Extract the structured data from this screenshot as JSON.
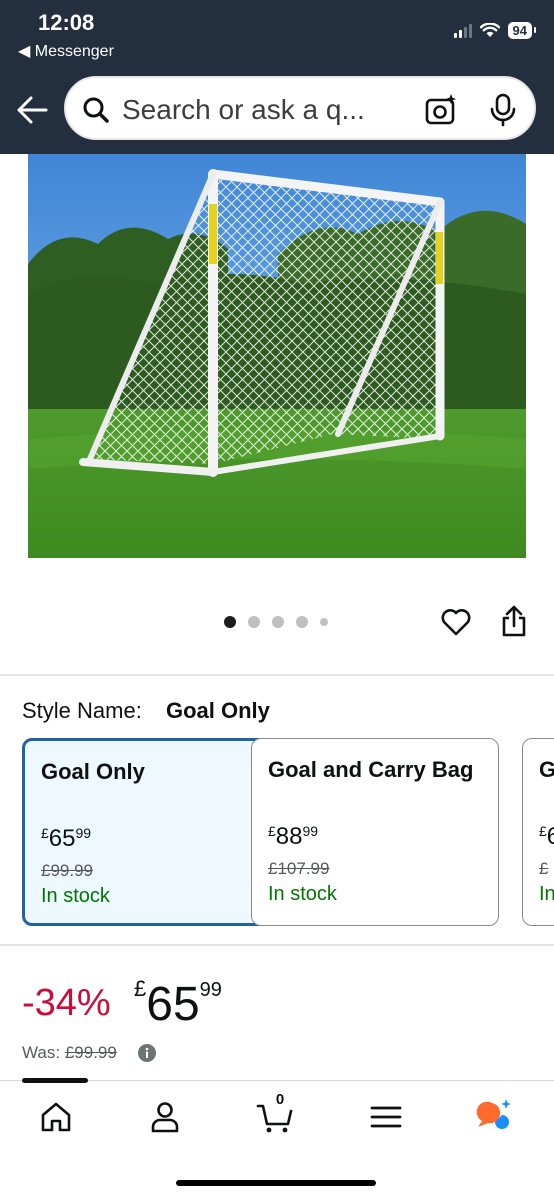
{
  "status_bar": {
    "time": "12:08",
    "back_app": "◀ Messenger",
    "battery": "94"
  },
  "search": {
    "placeholder": "Search or ask a q..."
  },
  "product": {
    "image_alt": "White football goal with net on grass",
    "carousel": {
      "total": 5,
      "active_index": 0
    }
  },
  "style": {
    "label": "Style Name:",
    "selected": "Goal Only",
    "options": [
      {
        "title": "Goal Only",
        "currency": "£",
        "whole": "65",
        "fraction": "99",
        "was": "£99.99",
        "stock": "In stock",
        "selected": true
      },
      {
        "title": "Goal and Carry Bag",
        "currency": "£",
        "whole": "88",
        "fraction": "99",
        "was": "£107.99",
        "stock": "In stock",
        "selected": false
      },
      {
        "title": "G",
        "currency": "£",
        "whole": "6",
        "fraction": "",
        "was": "£",
        "stock": "In",
        "selected": false
      }
    ]
  },
  "price": {
    "discount": "-34%",
    "currency": "£",
    "whole": "65",
    "fraction": "99",
    "was_label": "Was:",
    "was_value": "£99.99"
  },
  "bottom_nav": {
    "cart_count": "0",
    "items": [
      "home-icon",
      "account-icon",
      "cart-icon",
      "menu-icon",
      "rufus-icon"
    ]
  },
  "colors": {
    "header_bg": "#232f3e",
    "discount_red": "#cc0c39",
    "stock_green": "#007600",
    "selected_border": "#2162a1",
    "selected_bg": "#edf8ff",
    "rufus_orange": "#ff6b2c",
    "rufus_blue": "#1a8cff"
  }
}
